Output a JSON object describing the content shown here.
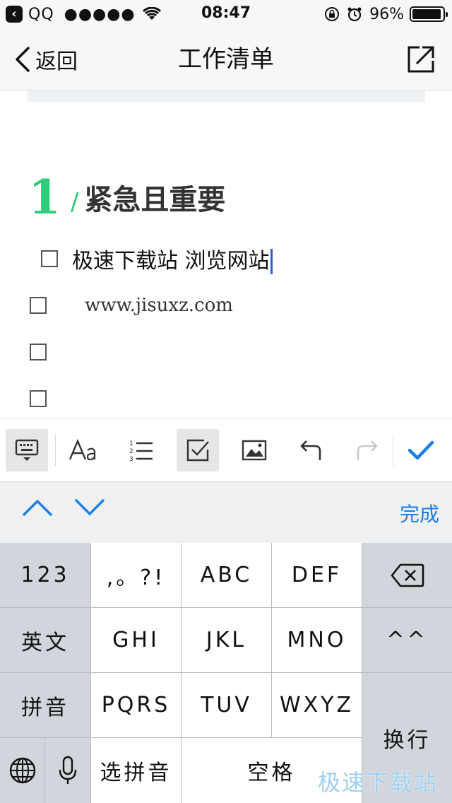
{
  "status_bar": {
    "back_app_glyph": "‹",
    "carrier": "QQ",
    "signal": "●●●●●",
    "time": "08:47",
    "battery_text": "96%",
    "battery_level": 0.96
  },
  "nav": {
    "back_label": "返回",
    "title": "工作清单",
    "share_icon": "share-external-icon"
  },
  "editor": {
    "section_number": "1",
    "section_slash": "/",
    "section_title": "紧急且重要",
    "todos": [
      {
        "text": "极速下载站 浏览网站",
        "checked": false,
        "has_caret": true
      },
      {
        "text": "www.jisuxz.com",
        "checked": false
      },
      {
        "text": "",
        "checked": false
      },
      {
        "text": "",
        "checked": false
      }
    ]
  },
  "toolbar": {
    "items": [
      "keyboard-hide-icon",
      "font-style-icon",
      "numbered-list-icon",
      "checkbox-icon",
      "image-icon",
      "undo-icon",
      "redo-icon",
      "confirm-check-icon"
    ],
    "active": [
      "keyboard-hide-icon",
      "checkbox-icon"
    ],
    "accent": "#1a7ee8"
  },
  "accessory": {
    "done_label": "完成"
  },
  "keyboard": {
    "row1": [
      "123",
      ",。?!",
      "ABC",
      "DEF",
      "delete-icon"
    ],
    "row2": [
      "英文",
      "GHI",
      "JKL",
      "MNO",
      "^^"
    ],
    "row3": [
      "拼音",
      "PQRS",
      "TUV",
      "WXYZ",
      "换行"
    ],
    "row4": [
      "globe-icon",
      "mic-icon",
      "选拼音",
      "空格"
    ]
  },
  "watermark": "极速下载站"
}
